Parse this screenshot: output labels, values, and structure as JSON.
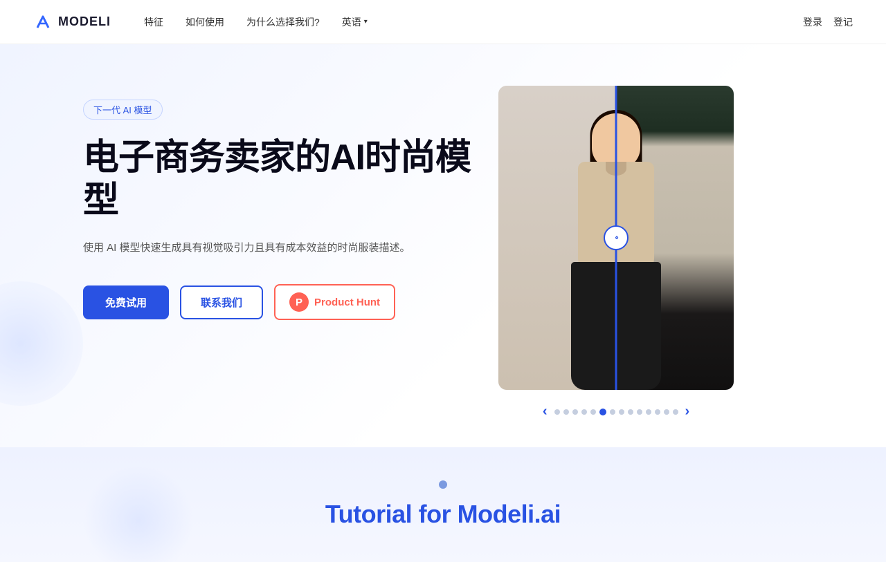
{
  "nav": {
    "logo_text": "MODELI",
    "links": [
      {
        "label": "特征",
        "id": "features"
      },
      {
        "label": "如何使用",
        "id": "how-to-use"
      },
      {
        "label": "为什么选择我们?",
        "id": "why-us"
      },
      {
        "label": "英语",
        "id": "language",
        "has_dropdown": true
      }
    ],
    "login": "登录",
    "register": "登记"
  },
  "hero": {
    "badge": "下一代 AI 模型",
    "title": "电子商务卖家的AI时尚模型",
    "subtitle": "使用 AI 模型快速生成具有视觉吸引力且具有成本效益的时尚服装描述。",
    "btn_free": "免费试用",
    "btn_contact": "联系我们",
    "btn_ph": "Product Hunt",
    "ph_icon_letter": "P"
  },
  "carousel": {
    "prev_icon": "‹",
    "next_icon": "›",
    "total_dots": 14,
    "active_dot": 6
  },
  "tutorial": {
    "title": "Tutorial for Modeli.ai"
  }
}
